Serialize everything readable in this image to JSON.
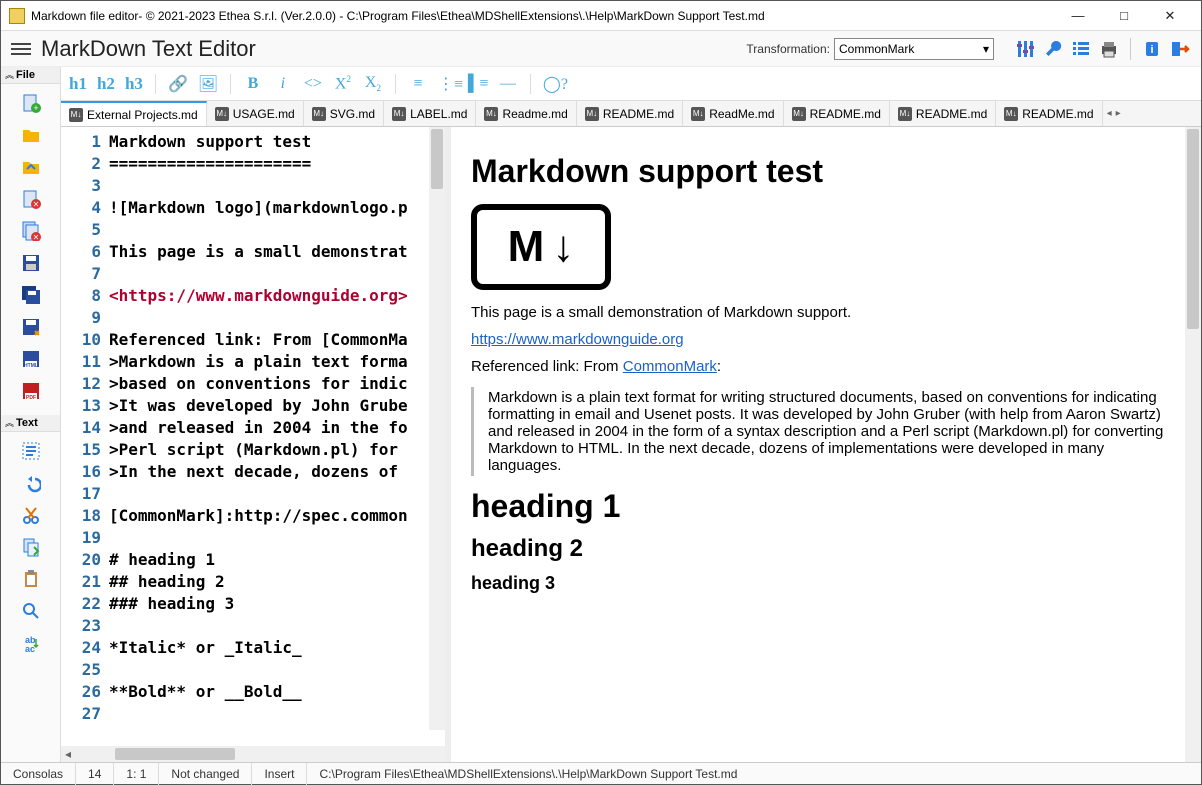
{
  "window": {
    "title": "Markdown file editor- © 2021-2023 Ethea S.r.l. (Ver.2.0.0) - C:\\Program Files\\Ethea\\MDShellExtensions\\.\\Help\\MarkDown Support Test.md"
  },
  "header": {
    "app_title": "MarkDown Text Editor",
    "transformation_label": "Transformation:",
    "transformation_value": "CommonMark"
  },
  "left_panel": {
    "section_file": "File",
    "section_text": "Text"
  },
  "format_bar": {
    "h1": "h1",
    "h2": "h2",
    "h3": "h3",
    "bold": "B",
    "italic": "i"
  },
  "tabs": [
    {
      "label": "External Projects.md",
      "active": true
    },
    {
      "label": "USAGE.md",
      "active": false
    },
    {
      "label": "SVG.md",
      "active": false
    },
    {
      "label": "LABEL.md",
      "active": false
    },
    {
      "label": "Readme.md",
      "active": false
    },
    {
      "label": "README.md",
      "active": false
    },
    {
      "label": "ReadMe.md",
      "active": false
    },
    {
      "label": "README.md",
      "active": false
    },
    {
      "label": "README.md",
      "active": false
    },
    {
      "label": "README.md",
      "active": false
    }
  ],
  "editor": {
    "lines": [
      "Markdown support test",
      "=====================",
      "",
      "![Markdown logo](markdownlogo.p",
      "",
      "This page is a small demonstrat",
      "",
      "<https://www.markdownguide.org>",
      "",
      "Referenced link: From [CommonMa",
      ">Markdown is a plain text forma",
      ">based on conventions for indic",
      ">It was developed by John Grube",
      ">and released in 2004 in the fo",
      ">Perl script (Markdown.pl) for ",
      ">In the next decade, dozens of ",
      "",
      "[CommonMark]:http://spec.common",
      "",
      "# heading 1",
      "## heading 2",
      "### heading 3",
      "",
      "*Italic* or _Italic_",
      "",
      "**Bold** or __Bold__",
      ""
    ],
    "url_line_index": 7
  },
  "preview": {
    "h_title": "Markdown support test",
    "p_intro": "This page is a small demonstration of Markdown support.",
    "link_url": "https://www.markdownguide.org",
    "ref_prefix": "Referenced link: From ",
    "ref_link": "CommonMark",
    "ref_suffix": ":",
    "blockquote": "Markdown is a plain text format for writing structured documents, based on conventions for indicating formatting in email and Usenet posts. It was developed by John Gruber (with help from Aaron Swartz) and released in 2004 in the form of a syntax description and a Perl script (Markdown.pl) for converting Markdown to HTML. In the next decade, dozens of implementations were developed in many languages.",
    "h1": "heading 1",
    "h2": "heading 2",
    "h3": "heading 3"
  },
  "status": {
    "font": "Consolas",
    "size": "14",
    "pos": "1:  1",
    "changed": "Not changed",
    "mode": "Insert",
    "path": "C:\\Program Files\\Ethea\\MDShellExtensions\\.\\Help\\MarkDown Support Test.md"
  }
}
